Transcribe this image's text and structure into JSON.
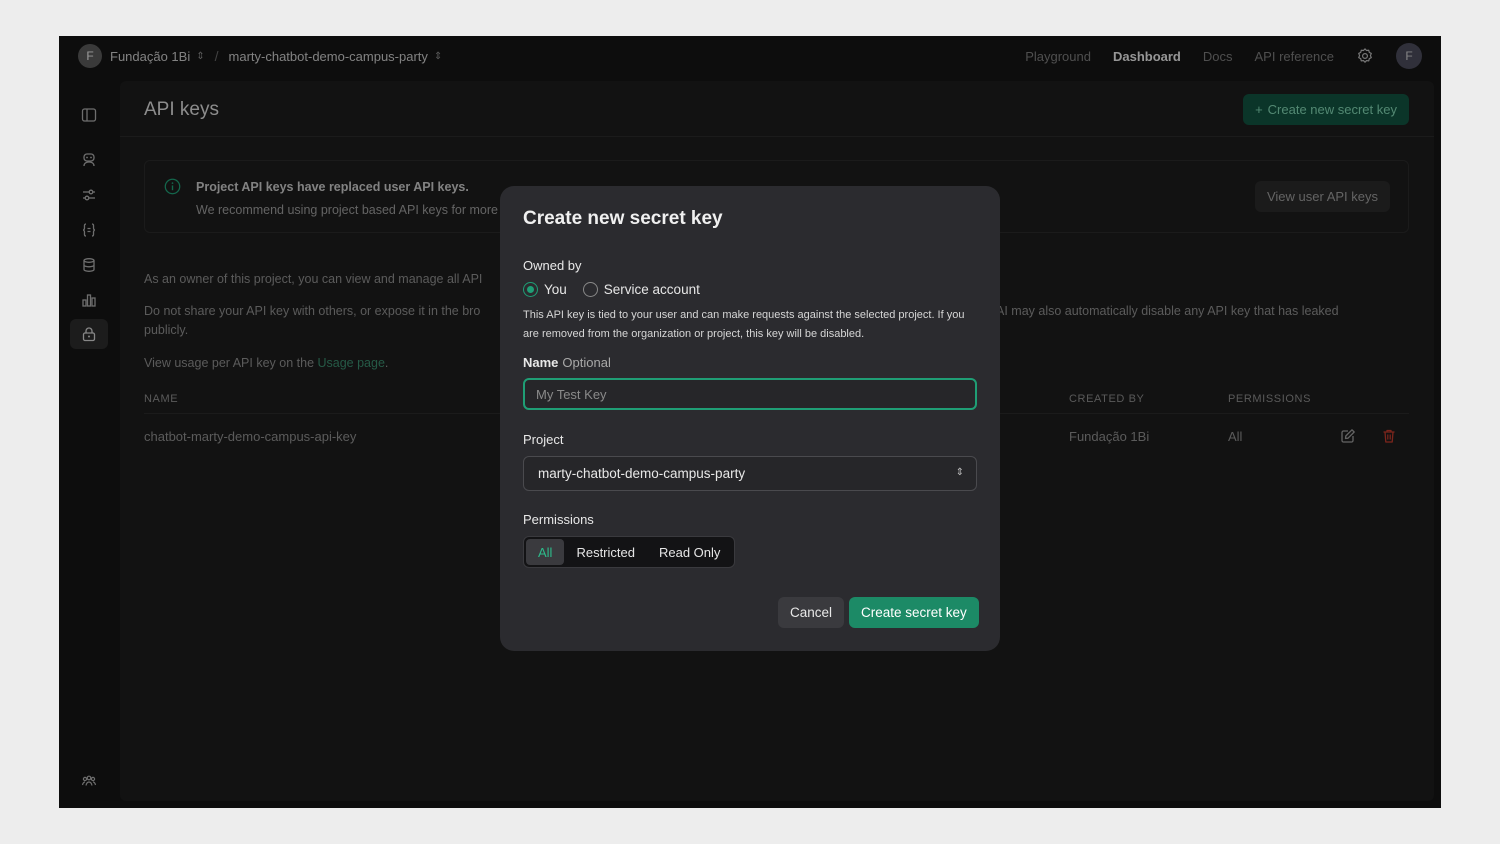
{
  "topbar": {
    "org_initial": "F",
    "org_name": "Fundação 1Bi",
    "separator": "/",
    "project_name": "marty-chatbot-demo-campus-party",
    "nav": [
      "Playground",
      "Dashboard",
      "Docs",
      "API reference"
    ],
    "active_nav": "Dashboard",
    "user_initial": "F"
  },
  "sidebar": {
    "icons": [
      "panel-toggle-icon",
      "assistants-icon",
      "tune-icon",
      "json-braces-icon",
      "storage-icon",
      "usage-chart-icon",
      "api-keys-lock-icon",
      "team-icon",
      "help-icon"
    ],
    "active": "api-keys-lock-icon"
  },
  "page": {
    "title": "API keys",
    "create_button": "Create new secret key",
    "banner": {
      "title": "Project API keys have replaced user API keys.",
      "text": "We recommend using project based API keys for more",
      "button": "View user API keys"
    },
    "para1": "As an owner of this project, you can view and manage all API",
    "para2_left": "Do not share your API key with others, or expose it in the bro",
    "para2_right": "AI may also automatically disable any API key that has leaked",
    "para2_line2": "publicly.",
    "para3_prefix": "View usage per API key on the ",
    "para3_link": "Usage page",
    "para3_suffix": ".",
    "columns": {
      "name": "NAME",
      "created_by": "CREATED BY",
      "permissions": "PERMISSIONS"
    },
    "rows": [
      {
        "name": "chatbot-marty-demo-campus-api-key",
        "created_by": "Fundação 1Bi",
        "permissions": "All"
      }
    ]
  },
  "modal": {
    "title": "Create new secret key",
    "owned_by_label": "Owned by",
    "owner_options": [
      "You",
      "Service account"
    ],
    "owner_selected": "You",
    "help_text": "This API key is tied to your user and can make requests against the selected project. If you are removed from the organization or project, this key will be disabled.",
    "name_label": "Name",
    "name_optional": "Optional",
    "name_placeholder": "My Test Key",
    "name_value": "",
    "project_label": "Project",
    "project_value": "marty-chatbot-demo-campus-party",
    "permissions_label": "Permissions",
    "permission_options": [
      "All",
      "Restricted",
      "Read Only"
    ],
    "permission_selected": "All",
    "cancel": "Cancel",
    "submit": "Create secret key"
  },
  "colors": {
    "accent": "#1f9e75",
    "primary_button": "#1c8a66",
    "danger": "#c0392b",
    "link": "#3a8a6c"
  }
}
